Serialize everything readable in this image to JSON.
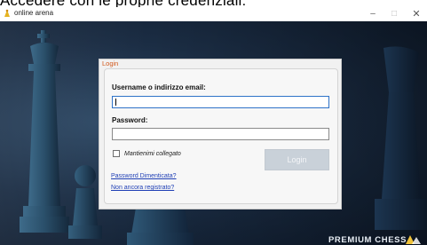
{
  "caption": {
    "text": "Accedere con le proprie credenziali:"
  },
  "window": {
    "title": "online arena",
    "minimize_label": "–",
    "maximize_label": "□",
    "close_label": "✕"
  },
  "login": {
    "title": "Login",
    "username_label": "Username o indirizzo email:",
    "username_value": "",
    "password_label": "Password:",
    "password_value": "",
    "remember_label": "Mantienimi collegato",
    "remember_checked": false,
    "login_button": "Login",
    "forgot_link": "Password Dimenticata?",
    "register_link": "Non ancora registrato?"
  },
  "brand": {
    "text": "PREMIUM CHESS"
  },
  "colors": {
    "accent": "#d25a1e",
    "link": "#1f3fb5",
    "focus": "#2f73c8",
    "button_disabled": "#c9d1d9"
  }
}
